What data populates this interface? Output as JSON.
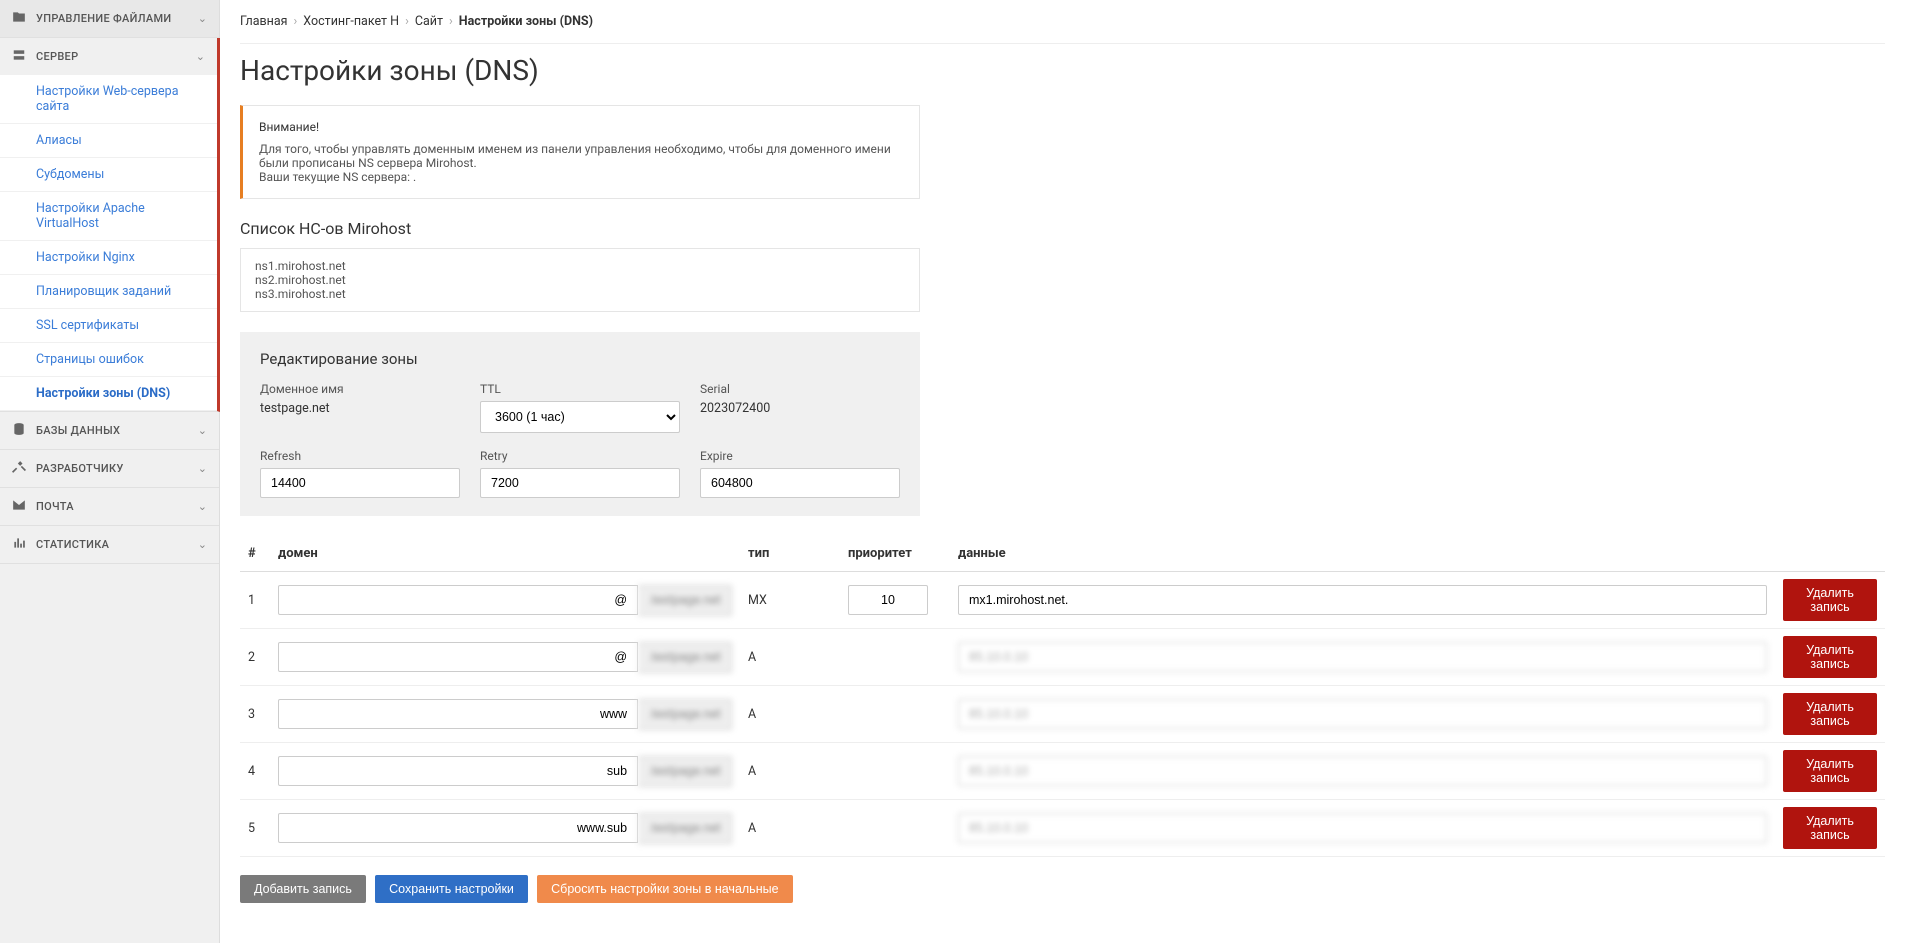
{
  "sidebar": {
    "sections": [
      {
        "key": "files",
        "label": "УПРАВЛЕНИЕ ФАЙЛАМИ",
        "icon": "folder",
        "open": false
      },
      {
        "key": "server",
        "label": "СЕРВЕР",
        "icon": "server",
        "open": true,
        "items": [
          {
            "label": "Настройки Web-сервера сайта"
          },
          {
            "label": "Алиасы"
          },
          {
            "label": "Субдомены"
          },
          {
            "label": "Настройки Apache VirtualHost"
          },
          {
            "label": "Настройки Nginx"
          },
          {
            "label": "Планировщик заданий"
          },
          {
            "label": "SSL сертификаты"
          },
          {
            "label": "Страницы ошибок"
          },
          {
            "label": "Настройки зоны (DNS)",
            "active": true
          }
        ]
      },
      {
        "key": "db",
        "label": "БАЗЫ ДАННЫХ",
        "icon": "db",
        "open": false
      },
      {
        "key": "dev",
        "label": "РАЗРАБОТЧИКУ",
        "icon": "tools",
        "open": false
      },
      {
        "key": "mail",
        "label": "ПОЧТА",
        "icon": "mail",
        "open": false
      },
      {
        "key": "stats",
        "label": "СТАТИСТИКА",
        "icon": "chart",
        "open": false
      }
    ]
  },
  "breadcrumb": {
    "items": [
      "Главная",
      "Хостинг-пакет H",
      "Сайт",
      "Настройки зоны (DNS)"
    ]
  },
  "page_title": "Настройки зоны (DNS)",
  "alert": {
    "title": "Внимание!",
    "line1": "Для того, чтобы управлять доменным именем из панели управления необходимо, чтобы для доменного имени были прописаны NS сервера Mirohost.",
    "line2": "Ваши текущие NS сервера: ."
  },
  "ns_section": {
    "title": "Список НС-ов Mirohost",
    "items": [
      "ns1.mirohost.net",
      "ns2.mirohost.net",
      "ns3.mirohost.net"
    ]
  },
  "zone_edit": {
    "title": "Редактирование зоны",
    "domain_label": "Доменное имя",
    "domain_value": "testpage.net",
    "ttl_label": "TTL",
    "ttl_value": "3600 (1 час)",
    "serial_label": "Serial",
    "serial_value": "2023072400",
    "refresh_label": "Refresh",
    "refresh_value": "14400",
    "retry_label": "Retry",
    "retry_value": "7200",
    "expire_label": "Expire",
    "expire_value": "604800"
  },
  "table": {
    "headers": {
      "num": "#",
      "domain": "домен",
      "type": "тип",
      "priority": "приоритет",
      "data": "данные"
    },
    "suffix_placeholder": ".testpage.net",
    "rows": [
      {
        "n": "1",
        "sub": "@",
        "type": "MX",
        "prio": "10",
        "data": "mx1.mirohost.net.",
        "blur": false
      },
      {
        "n": "2",
        "sub": "@",
        "type": "A",
        "prio": "",
        "data": "85.10.0.10",
        "blur": true
      },
      {
        "n": "3",
        "sub": "www",
        "type": "A",
        "prio": "",
        "data": "85.10.0.10",
        "blur": true
      },
      {
        "n": "4",
        "sub": "sub",
        "type": "A",
        "prio": "",
        "data": "85.10.0.10",
        "blur": true
      },
      {
        "n": "5",
        "sub": "www.sub",
        "type": "A",
        "prio": "",
        "data": "85.10.0.10",
        "blur": true
      }
    ],
    "delete_label": "Удалить запись"
  },
  "actions": {
    "add": "Добавить запись",
    "save": "Сохранить настройки",
    "reset": "Сбросить настройки зоны в начальные"
  }
}
